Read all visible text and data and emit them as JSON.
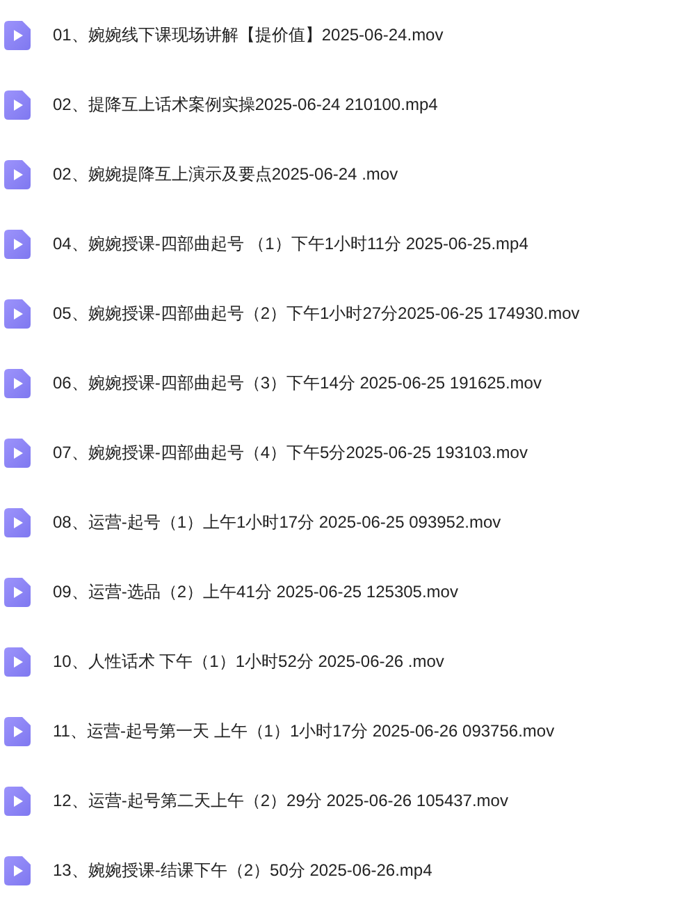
{
  "files": [
    {
      "name": "01、婉婉线下课现场讲解【提价值】2025-06-24.mov"
    },
    {
      "name": "02、提降互上话术案例实操2025-06-24 210100.mp4"
    },
    {
      "name": "02、婉婉提降互上演示及要点2025-06-24 .mov"
    },
    {
      "name": "04、婉婉授课-四部曲起号 （1）下午1小时11分 2025-06-25.mp4"
    },
    {
      "name": "05、婉婉授课-四部曲起号（2）下午1小时27分2025-06-25 174930.mov"
    },
    {
      "name": "06、婉婉授课-四部曲起号（3）下午14分 2025-06-25 191625.mov"
    },
    {
      "name": "07、婉婉授课-四部曲起号（4）下午5分2025-06-25 193103.mov"
    },
    {
      "name": "08、运营-起号（1）上午1小时17分 2025-06-25 093952.mov"
    },
    {
      "name": "09、运营-选品（2）上午41分 2025-06-25 125305.mov"
    },
    {
      "name": "10、人性话术 下午（1）1小时52分 2025-06-26 .mov"
    },
    {
      "name": "11、运营-起号第一天 上午（1）1小时17分 2025-06-26 093756.mov"
    },
    {
      "name": "12、运营-起号第二天上午（2）29分 2025-06-26 105437.mov"
    },
    {
      "name": "13、婉婉授课-结课下午（2）50分 2025-06-26.mp4"
    }
  ]
}
